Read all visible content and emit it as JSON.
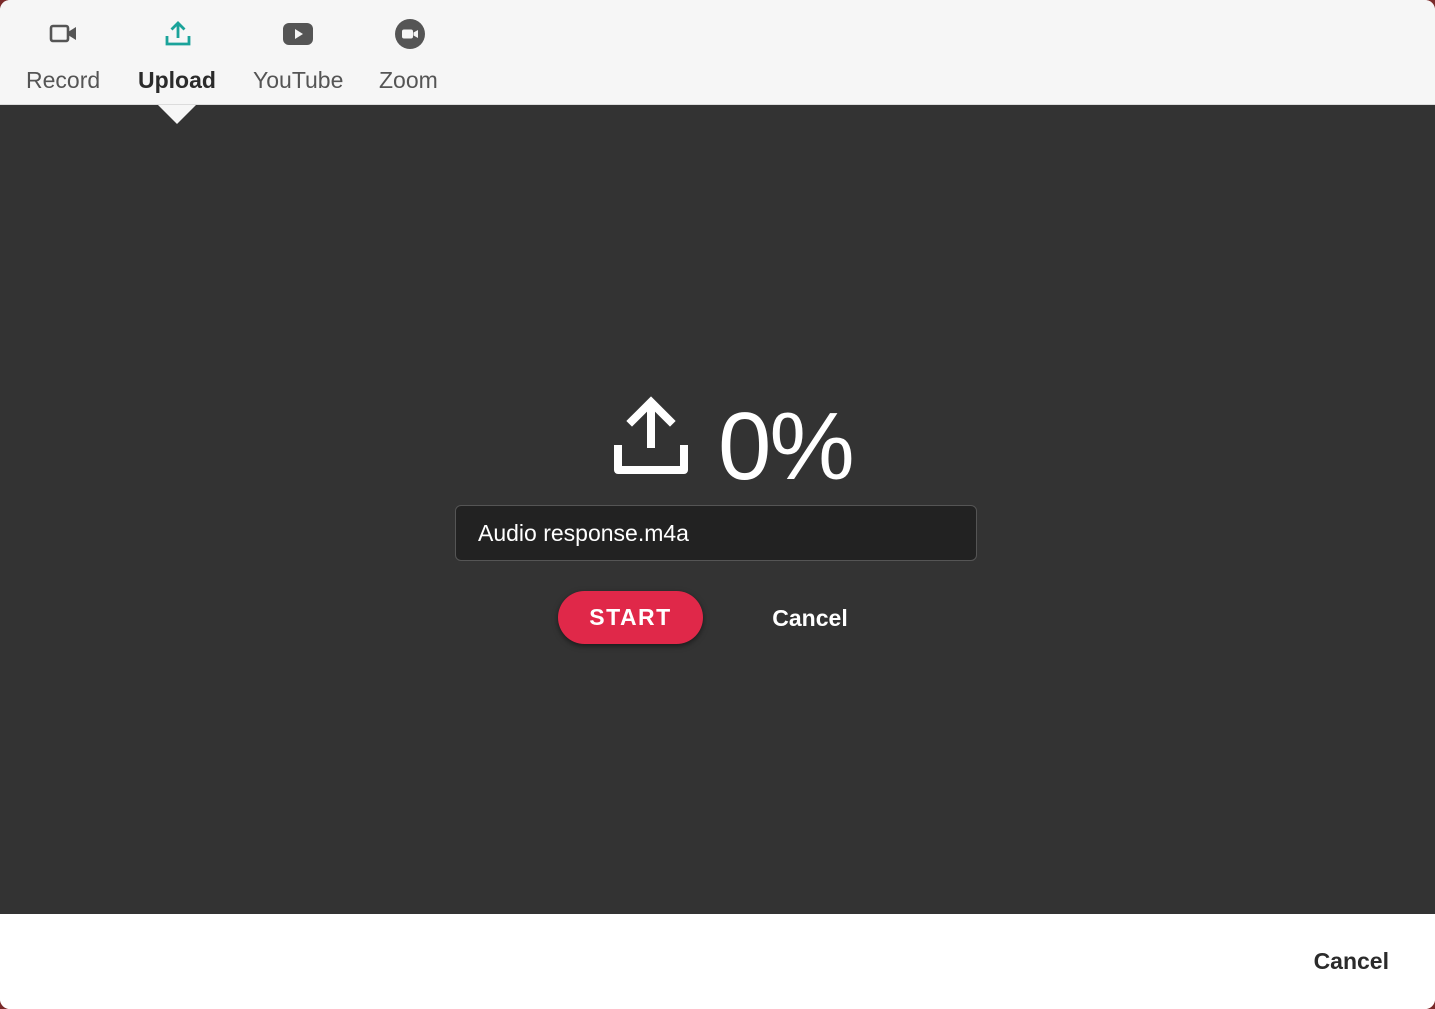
{
  "tabs": [
    {
      "label": "Record",
      "icon": "video-camera-icon",
      "active": false
    },
    {
      "label": "Upload",
      "icon": "upload-icon",
      "active": true
    },
    {
      "label": "YouTube",
      "icon": "youtube-icon",
      "active": false
    },
    {
      "label": "Zoom",
      "icon": "zoom-icon",
      "active": false
    }
  ],
  "upload": {
    "progress_text": "0%",
    "progress_value": 0,
    "filename": "Audio response.m4a",
    "start_label": "START",
    "cancel_label": "Cancel"
  },
  "footer": {
    "cancel_label": "Cancel"
  },
  "colors": {
    "accent": "#1aa39a",
    "start_button": "#e02849",
    "stage_background": "#333333",
    "tabbar_background": "#f6f6f6"
  }
}
